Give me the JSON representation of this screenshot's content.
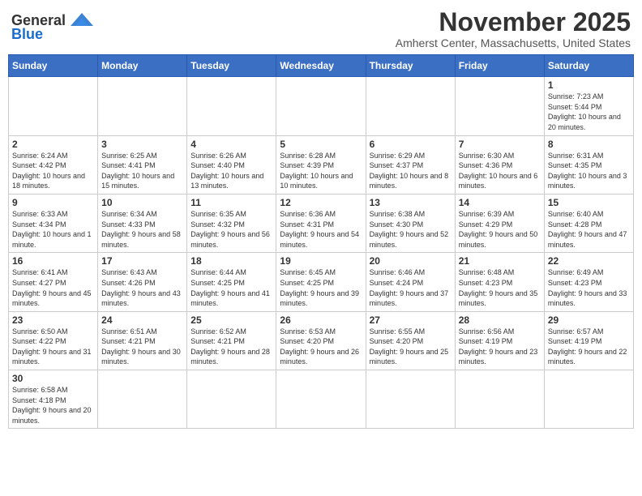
{
  "header": {
    "logo_general": "General",
    "logo_blue": "Blue",
    "month_title": "November 2025",
    "location": "Amherst Center, Massachusetts, United States"
  },
  "weekdays": [
    "Sunday",
    "Monday",
    "Tuesday",
    "Wednesday",
    "Thursday",
    "Friday",
    "Saturday"
  ],
  "weeks": [
    [
      {
        "day": "",
        "info": ""
      },
      {
        "day": "",
        "info": ""
      },
      {
        "day": "",
        "info": ""
      },
      {
        "day": "",
        "info": ""
      },
      {
        "day": "",
        "info": ""
      },
      {
        "day": "",
        "info": ""
      },
      {
        "day": "1",
        "info": "Sunrise: 7:23 AM\nSunset: 5:44 PM\nDaylight: 10 hours and 20 minutes."
      }
    ],
    [
      {
        "day": "2",
        "info": "Sunrise: 6:24 AM\nSunset: 4:42 PM\nDaylight: 10 hours and 18 minutes."
      },
      {
        "day": "3",
        "info": "Sunrise: 6:25 AM\nSunset: 4:41 PM\nDaylight: 10 hours and 15 minutes."
      },
      {
        "day": "4",
        "info": "Sunrise: 6:26 AM\nSunset: 4:40 PM\nDaylight: 10 hours and 13 minutes."
      },
      {
        "day": "5",
        "info": "Sunrise: 6:28 AM\nSunset: 4:39 PM\nDaylight: 10 hours and 10 minutes."
      },
      {
        "day": "6",
        "info": "Sunrise: 6:29 AM\nSunset: 4:37 PM\nDaylight: 10 hours and 8 minutes."
      },
      {
        "day": "7",
        "info": "Sunrise: 6:30 AM\nSunset: 4:36 PM\nDaylight: 10 hours and 6 minutes."
      },
      {
        "day": "8",
        "info": "Sunrise: 6:31 AM\nSunset: 4:35 PM\nDaylight: 10 hours and 3 minutes."
      }
    ],
    [
      {
        "day": "9",
        "info": "Sunrise: 6:33 AM\nSunset: 4:34 PM\nDaylight: 10 hours and 1 minute."
      },
      {
        "day": "10",
        "info": "Sunrise: 6:34 AM\nSunset: 4:33 PM\nDaylight: 9 hours and 58 minutes."
      },
      {
        "day": "11",
        "info": "Sunrise: 6:35 AM\nSunset: 4:32 PM\nDaylight: 9 hours and 56 minutes."
      },
      {
        "day": "12",
        "info": "Sunrise: 6:36 AM\nSunset: 4:31 PM\nDaylight: 9 hours and 54 minutes."
      },
      {
        "day": "13",
        "info": "Sunrise: 6:38 AM\nSunset: 4:30 PM\nDaylight: 9 hours and 52 minutes."
      },
      {
        "day": "14",
        "info": "Sunrise: 6:39 AM\nSunset: 4:29 PM\nDaylight: 9 hours and 50 minutes."
      },
      {
        "day": "15",
        "info": "Sunrise: 6:40 AM\nSunset: 4:28 PM\nDaylight: 9 hours and 47 minutes."
      }
    ],
    [
      {
        "day": "16",
        "info": "Sunrise: 6:41 AM\nSunset: 4:27 PM\nDaylight: 9 hours and 45 minutes."
      },
      {
        "day": "17",
        "info": "Sunrise: 6:43 AM\nSunset: 4:26 PM\nDaylight: 9 hours and 43 minutes."
      },
      {
        "day": "18",
        "info": "Sunrise: 6:44 AM\nSunset: 4:25 PM\nDaylight: 9 hours and 41 minutes."
      },
      {
        "day": "19",
        "info": "Sunrise: 6:45 AM\nSunset: 4:25 PM\nDaylight: 9 hours and 39 minutes."
      },
      {
        "day": "20",
        "info": "Sunrise: 6:46 AM\nSunset: 4:24 PM\nDaylight: 9 hours and 37 minutes."
      },
      {
        "day": "21",
        "info": "Sunrise: 6:48 AM\nSunset: 4:23 PM\nDaylight: 9 hours and 35 minutes."
      },
      {
        "day": "22",
        "info": "Sunrise: 6:49 AM\nSunset: 4:23 PM\nDaylight: 9 hours and 33 minutes."
      }
    ],
    [
      {
        "day": "23",
        "info": "Sunrise: 6:50 AM\nSunset: 4:22 PM\nDaylight: 9 hours and 31 minutes."
      },
      {
        "day": "24",
        "info": "Sunrise: 6:51 AM\nSunset: 4:21 PM\nDaylight: 9 hours and 30 minutes."
      },
      {
        "day": "25",
        "info": "Sunrise: 6:52 AM\nSunset: 4:21 PM\nDaylight: 9 hours and 28 minutes."
      },
      {
        "day": "26",
        "info": "Sunrise: 6:53 AM\nSunset: 4:20 PM\nDaylight: 9 hours and 26 minutes."
      },
      {
        "day": "27",
        "info": "Sunrise: 6:55 AM\nSunset: 4:20 PM\nDaylight: 9 hours and 25 minutes."
      },
      {
        "day": "28",
        "info": "Sunrise: 6:56 AM\nSunset: 4:19 PM\nDaylight: 9 hours and 23 minutes."
      },
      {
        "day": "29",
        "info": "Sunrise: 6:57 AM\nSunset: 4:19 PM\nDaylight: 9 hours and 22 minutes."
      }
    ],
    [
      {
        "day": "30",
        "info": "Sunrise: 6:58 AM\nSunset: 4:18 PM\nDaylight: 9 hours and 20 minutes."
      },
      {
        "day": "",
        "info": ""
      },
      {
        "day": "",
        "info": ""
      },
      {
        "day": "",
        "info": ""
      },
      {
        "day": "",
        "info": ""
      },
      {
        "day": "",
        "info": ""
      },
      {
        "day": "",
        "info": ""
      }
    ]
  ]
}
